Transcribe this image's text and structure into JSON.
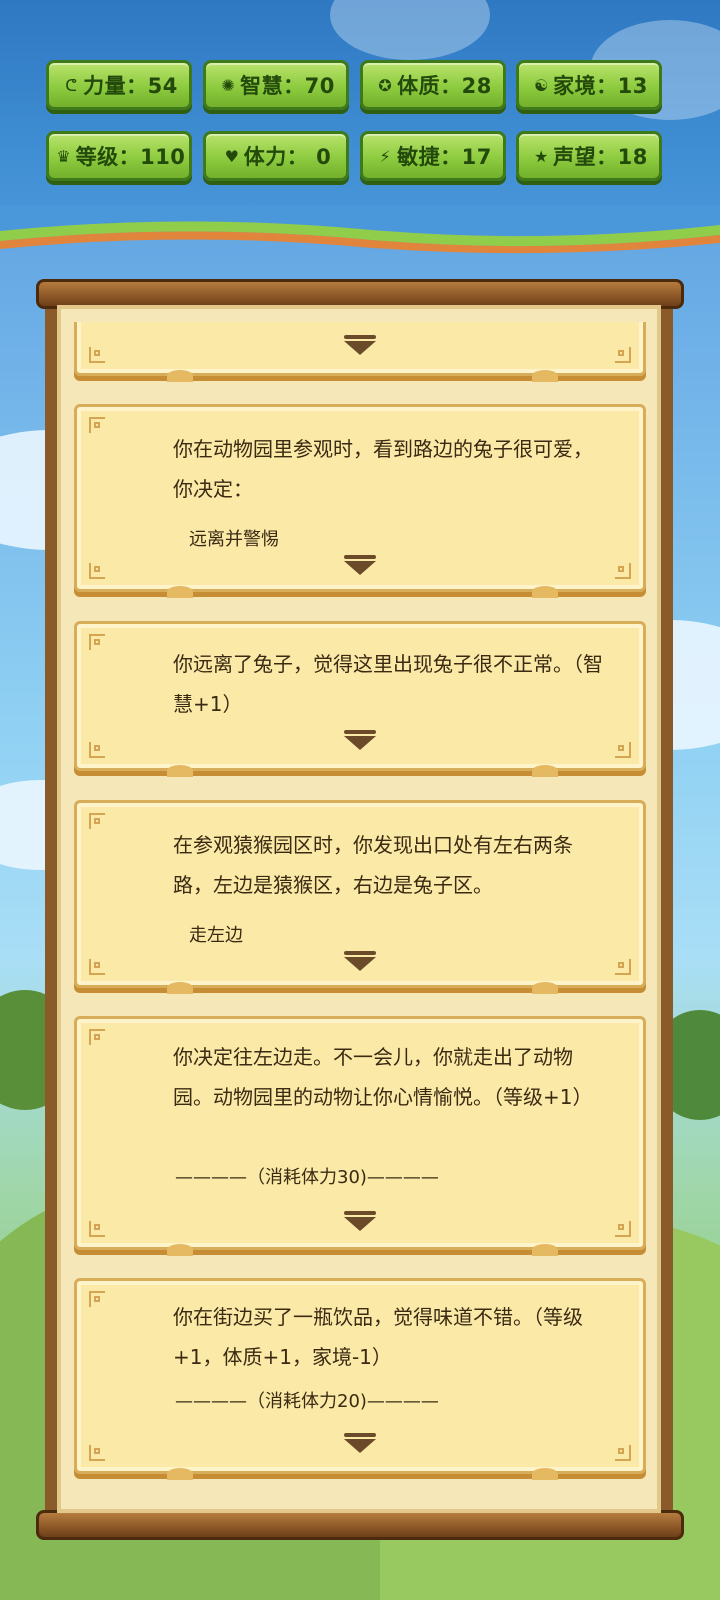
{
  "stats": [
    {
      "icon": "arm-icon",
      "glyph": "ᕦ",
      "label": "力量：54"
    },
    {
      "icon": "bulb-icon",
      "glyph": "✺",
      "label": "智慧：70"
    },
    {
      "icon": "body-icon",
      "glyph": "✪",
      "label": "体质：28"
    },
    {
      "icon": "home-icon",
      "glyph": "☯",
      "label": "家境：13"
    },
    {
      "icon": "crown-icon",
      "glyph": "♛",
      "label": "等级：110"
    },
    {
      "icon": "heart-icon",
      "glyph": "♥",
      "label": "体力： 0"
    },
    {
      "icon": "lightning-icon",
      "glyph": "⚡",
      "label": "敏捷：17"
    },
    {
      "icon": "star-icon",
      "glyph": "★",
      "label": "声望：18"
    }
  ],
  "events": [
    {
      "desc": "你在动物园里参观时，看到路边的兔子很可爱，你决定：",
      "choice": "远离并警惕",
      "cost": ""
    },
    {
      "desc": "你远离了兔子，觉得这里出现兔子很不正常。（智慧+1）",
      "choice": "",
      "cost": ""
    },
    {
      "desc": "在参观猿猴园区时，你发现出口处有左右两条路，左边是猿猴区，右边是兔子区。",
      "choice": "走左边",
      "cost": ""
    },
    {
      "desc": "你决定往左边走。不一会儿，你就走出了动物园。动物园里的动物让你心情愉悦。（等级+1）",
      "choice": "",
      "cost": "————（消耗体力30)————"
    },
    {
      "desc": "你在街边买了一瓶饮品，觉得味道不错。（等级+1，体质+1，家境-1）",
      "choice": "",
      "cost": "————（消耗体力20)————"
    }
  ],
  "colors": {
    "stat_green": "#8dcb3f",
    "card_bg": "#fbe9a8",
    "frame_brown": "#8a5a2b"
  }
}
